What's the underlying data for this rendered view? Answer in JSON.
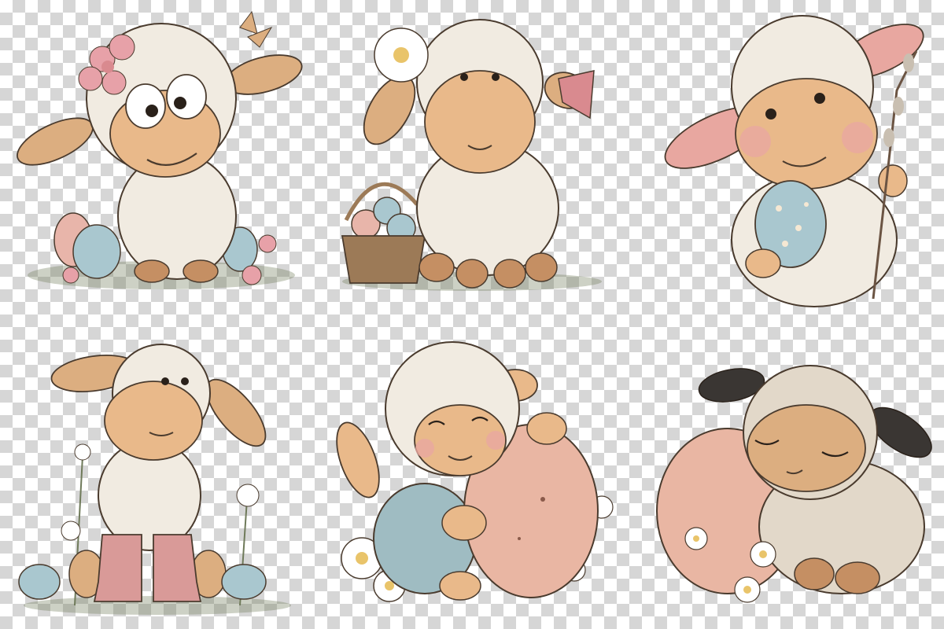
{
  "canvas": {
    "background": "transparent-checkerboard"
  },
  "palette": {
    "wool": "#f1ebe1",
    "wool_shadow": "#c9bfb1",
    "face": "#e9b98a",
    "face_shadow": "#c58f63",
    "ear_inner": "#e8a7a0",
    "outline": "#4a3b2e",
    "egg_blue": "#a9c7cf",
    "egg_pink": "#e8b5aa",
    "egg_peach": "#dcae80",
    "egg_big": "#e9b6a3",
    "boots": "#d99a98",
    "overalls": "#9fbcc2",
    "flower_pink": "#e7a1a8",
    "daisy": "#ffffff",
    "basket": "#9c7a57",
    "grass": "#6f7a5a"
  },
  "illustrations": [
    {
      "id": "lamb-pink-flower",
      "pose": "sitting",
      "props": [
        "pink-flower",
        "butterfly",
        "easter-eggs"
      ]
    },
    {
      "id": "lamb-daisy-basket",
      "pose": "sitting",
      "props": [
        "daisy",
        "egg-basket",
        "pink-bow"
      ]
    },
    {
      "id": "lamb-holding-egg",
      "pose": "standing",
      "props": [
        "spotted-egg",
        "pussy-willow-branch"
      ]
    },
    {
      "id": "lamb-in-boots",
      "pose": "standing",
      "props": [
        "pink-boots",
        "easter-eggs",
        "white-flowers"
      ]
    },
    {
      "id": "lamb-hugging-egg",
      "pose": "sitting",
      "props": [
        "big-pink-egg",
        "overalls",
        "daisies"
      ]
    },
    {
      "id": "lamb-sleeping-egg",
      "pose": "sleeping",
      "props": [
        "big-pink-egg",
        "daisies"
      ]
    }
  ]
}
